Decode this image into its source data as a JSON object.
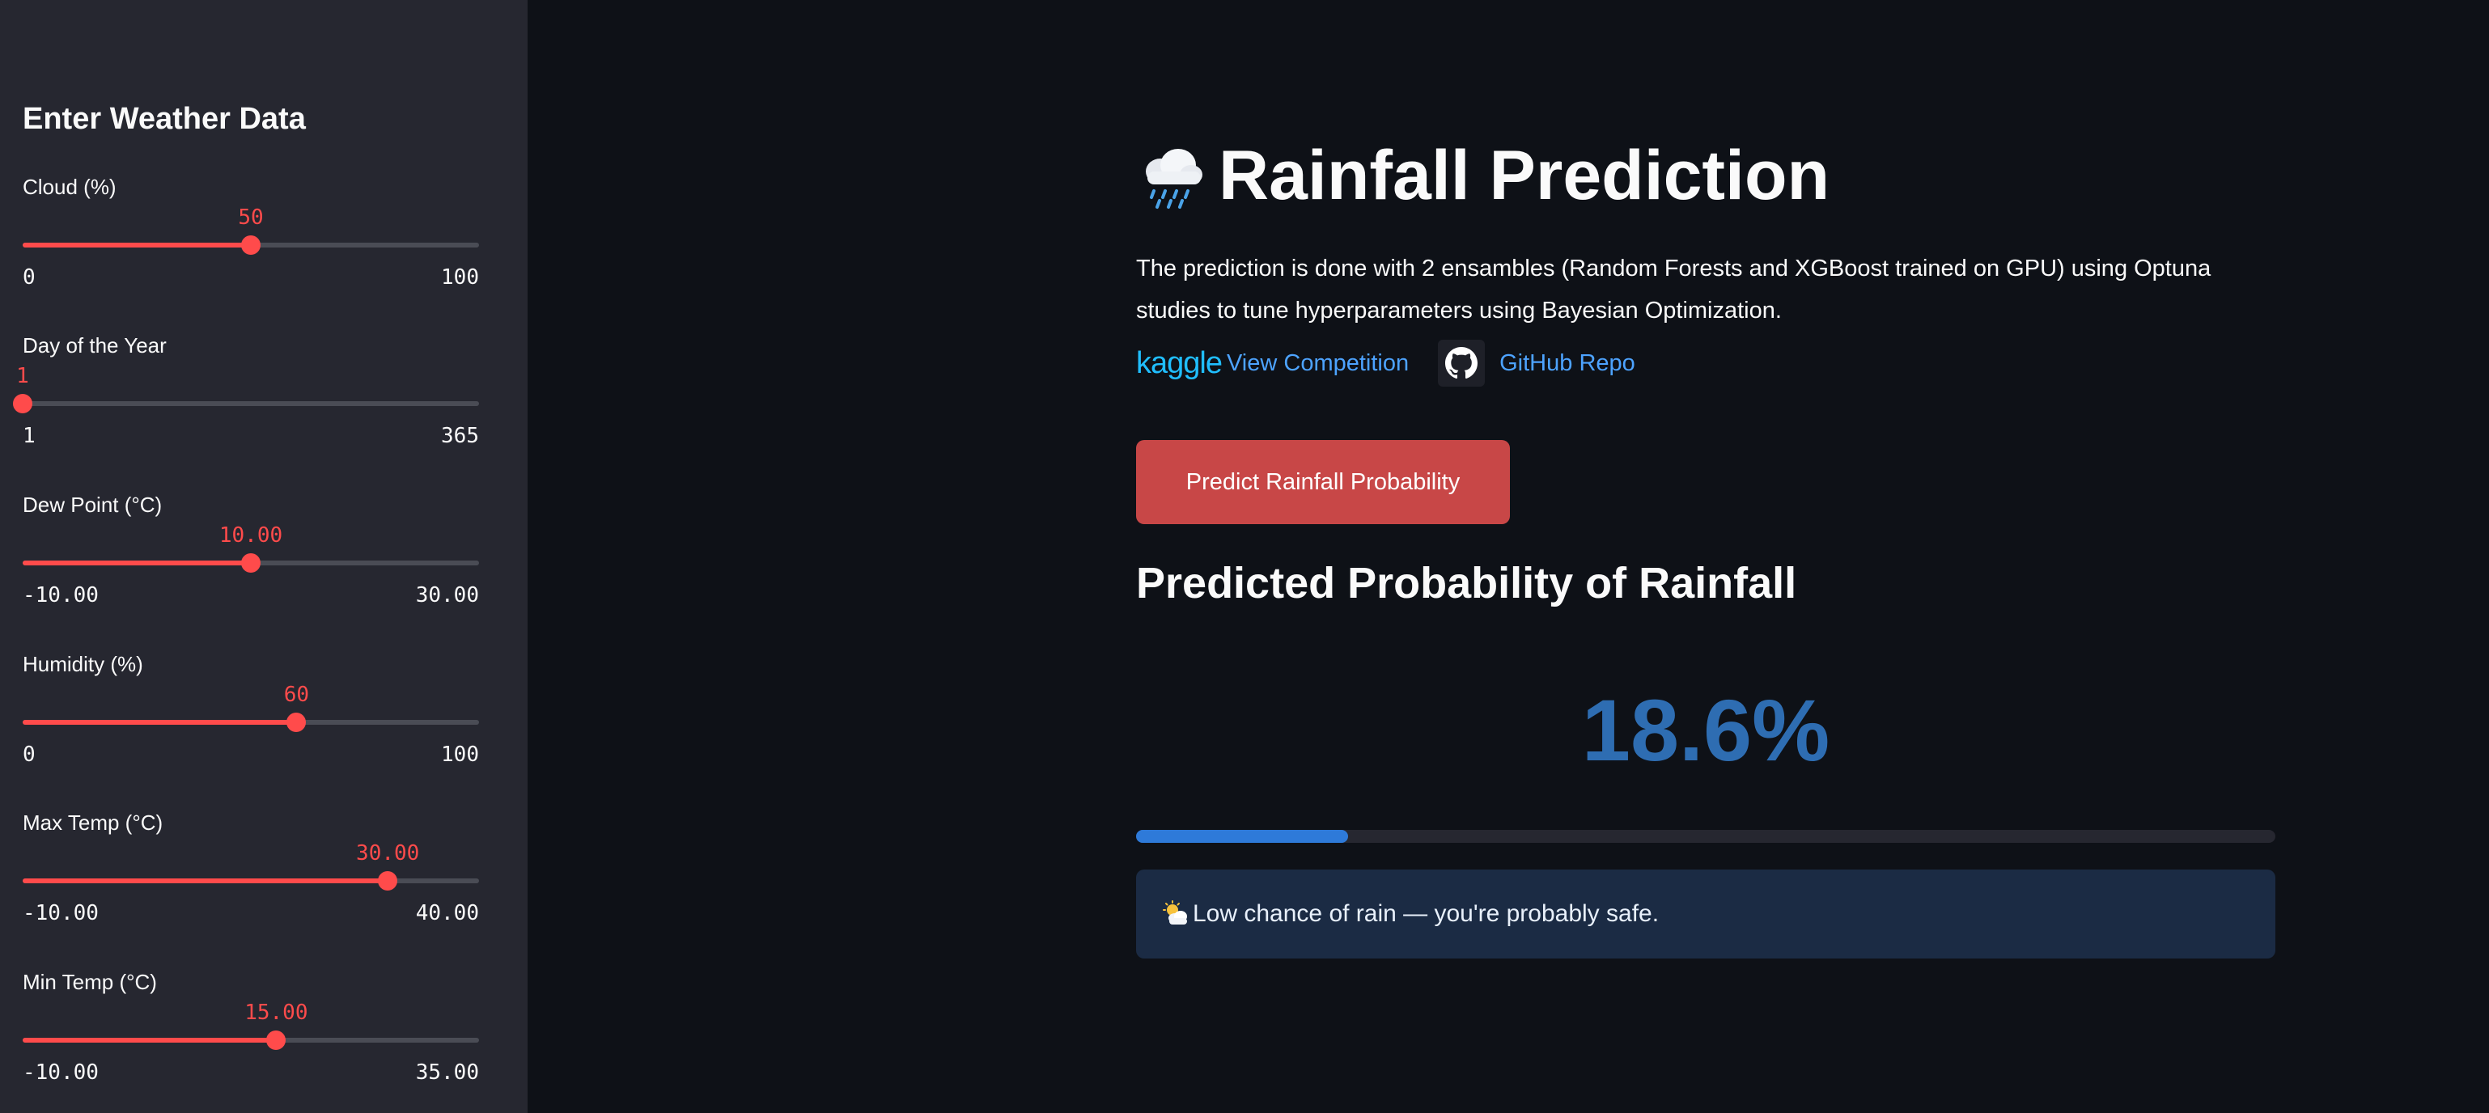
{
  "sidebar": {
    "title": "Enter Weather Data",
    "sliders": [
      {
        "label": "Cloud (%)",
        "value": "50",
        "min": "0",
        "max": "100",
        "fraction": 0.5
      },
      {
        "label": "Day of the Year",
        "value": "1",
        "min": "1",
        "max": "365",
        "fraction": 0.0
      },
      {
        "label": "Dew Point (°C)",
        "value": "10.00",
        "min": "-10.00",
        "max": "30.00",
        "fraction": 0.5
      },
      {
        "label": "Humidity (%)",
        "value": "60",
        "min": "0",
        "max": "100",
        "fraction": 0.6
      },
      {
        "label": "Max Temp (°C)",
        "value": "30.00",
        "min": "-10.00",
        "max": "40.00",
        "fraction": 0.8
      },
      {
        "label": "Min Temp (°C)",
        "value": "15.00",
        "min": "-10.00",
        "max": "35.00",
        "fraction": 0.5556
      }
    ]
  },
  "main": {
    "title": "Rainfall Prediction",
    "title_icon": "rain-cloud-icon",
    "description": "The prediction is done with 2 ensambles (Random Forests and XGBoost trained on GPU) using Optuna studies to tune hyperparameters using Bayesian Optimization.",
    "kaggle_logo": "kaggle",
    "kaggle_link": "View Competition",
    "github_link": "GitHub Repo",
    "predict_button": "Predict Rainfall Probability",
    "result_heading": "Predicted Probability of Rainfall",
    "probability": "18.6%",
    "probability_fraction": 0.186,
    "info_icon": "sun-behind-cloud-icon",
    "info_text": "Low chance of rain — you're probably safe."
  },
  "colors": {
    "accent": "#ff4b4b",
    "probability": "#2e6db2",
    "progress": "#2e7ad9",
    "link": "#4da3ff"
  }
}
